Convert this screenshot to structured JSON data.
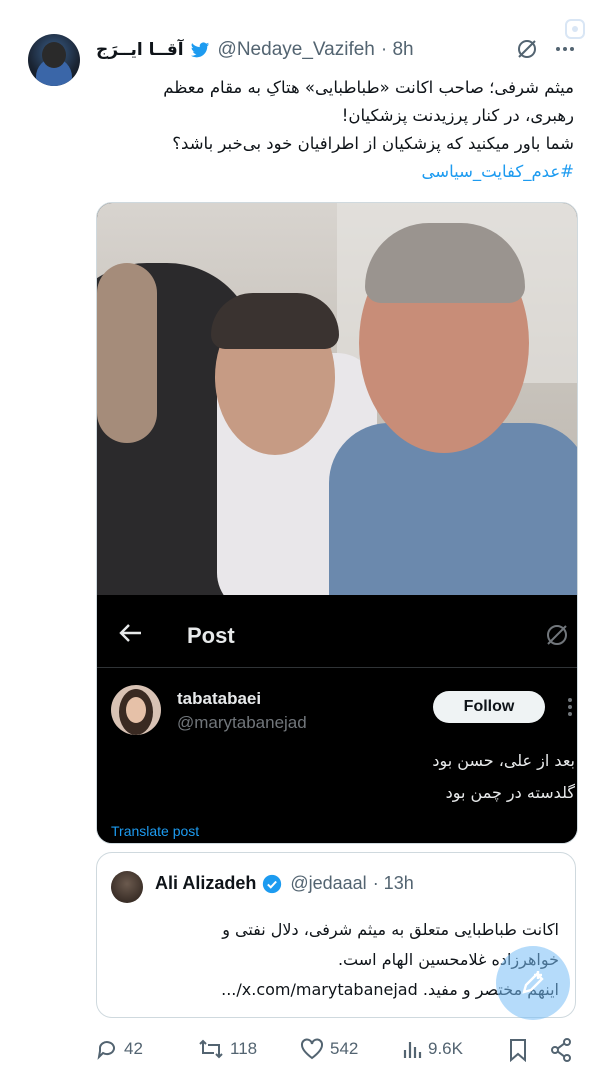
{
  "tweet": {
    "display_name": "آقــا ایــرَج",
    "handle": "@Nedaye_Vazifeh",
    "time": "· 8h",
    "text_lines": [
      "میثم شرفی؛ صاحب اکانت «طباطبایی» هتاکِ به مقام معظم",
      "رهبری، در کنار پرزیدنت پزشکیان!",
      "شما باور میکنید که پزشکیان از اطرافیان خود بی‌خبر باشد؟",
      "#عدم_کفایت_سیاسی"
    ]
  },
  "media": {
    "post_title": "Post",
    "author_name": "tabatabaei",
    "author_handle": "@marytabanejad",
    "follow_label": "Follow",
    "text_lines": [
      "بعد از علی، حسن بود",
      "گلدسته در چمن بود"
    ],
    "translate_label": "Translate post"
  },
  "quote": {
    "name": "Ali Alizadeh",
    "handle": "@jedaaal",
    "time": "· 13h",
    "text_lines": [
      "اکانت طباطبایی متعلق به میثم شرفی، دلال نفتی و",
      "خواهرزاده غلامحسین الهام است.",
      "اینهم مختصر و مفید. x.com/marytabanejad/..."
    ]
  },
  "actions": {
    "replies": "42",
    "reposts": "118",
    "likes": "542",
    "views": "9.6K"
  },
  "icons": [
    "twitter-bird-icon",
    "grok-icon",
    "more-icon",
    "back-arrow-icon",
    "verified-icon",
    "reply-icon",
    "repost-icon",
    "like-icon",
    "views-icon",
    "bookmark-icon",
    "share-icon",
    "compose-icon"
  ],
  "colors": {
    "accent": "#1d9bf0",
    "text": "#0f1419",
    "muted": "#536471"
  }
}
